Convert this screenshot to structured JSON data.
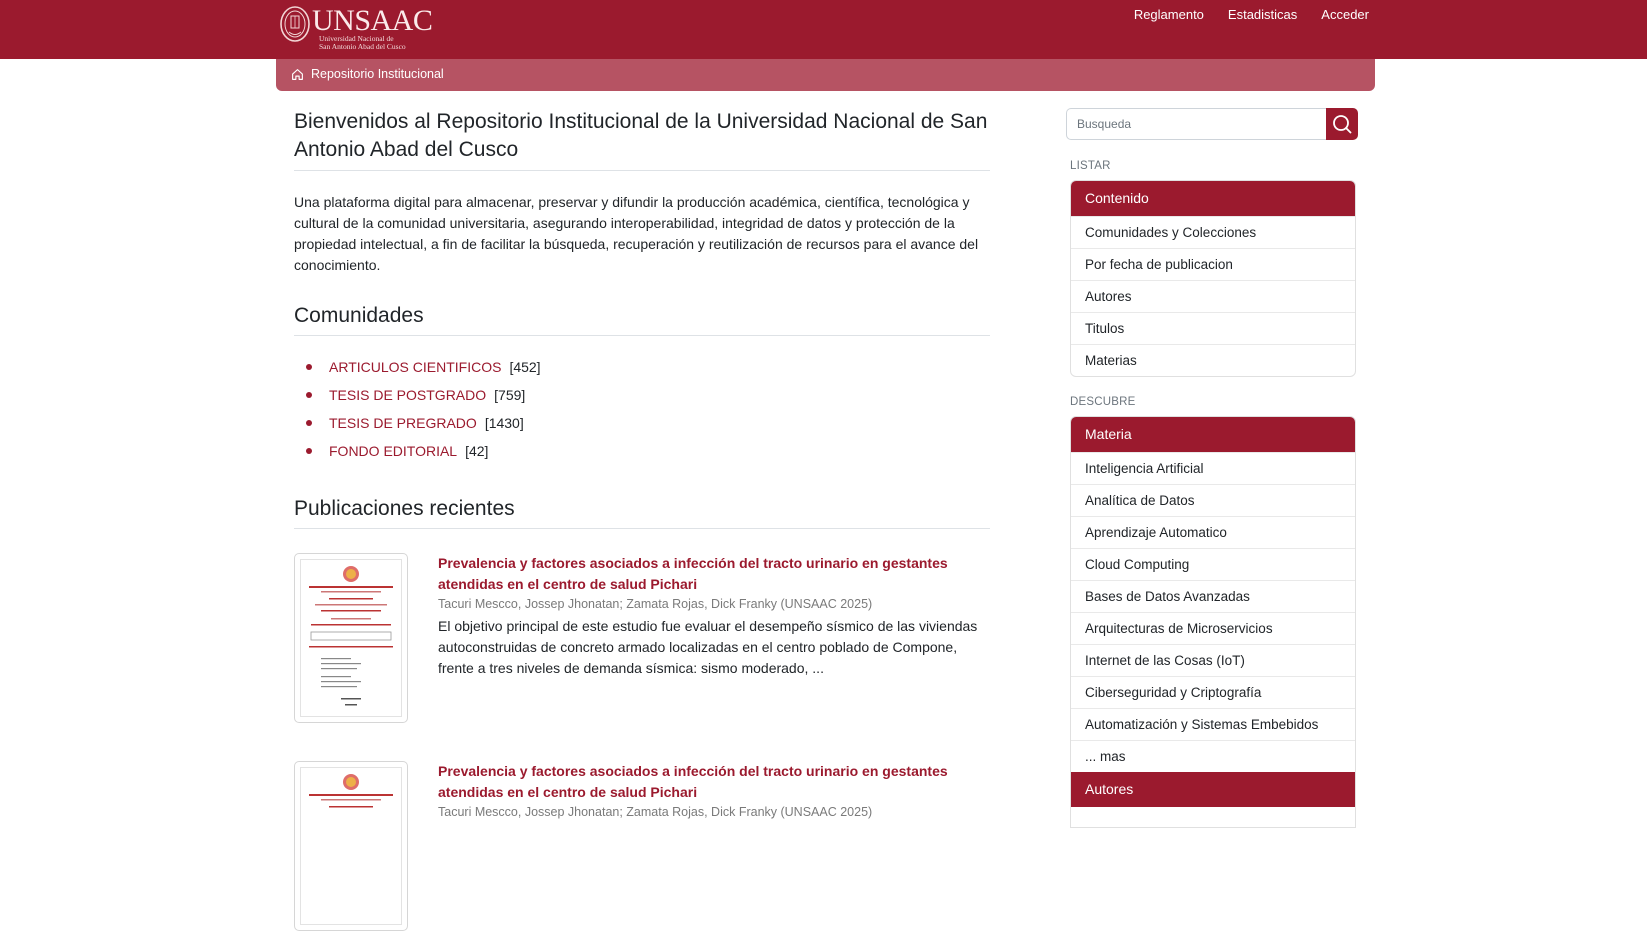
{
  "header": {
    "logo_text": "UNSAAC",
    "logo_subtitle_line1": "Universidad Nacional de",
    "logo_subtitle_line2": "San Antonio Abad del Cusco",
    "nav": [
      {
        "label": "Reglamento"
      },
      {
        "label": "Estadisticas"
      },
      {
        "label": "Acceder"
      }
    ]
  },
  "breadcrumb": {
    "label": "Repositorio Institucional"
  },
  "main": {
    "title": "Bienvenidos al Repositorio Institucional de la Universidad Nacional de San Antonio Abad del Cusco",
    "intro": "Una plataforma digital para almacenar, preservar y difundir la producción académica, científica, tecnológica y cultural de la comunidad universitaria, asegurando interoperabilidad, integridad de datos y protección de la propiedad intelectual, a fin de facilitar la búsqueda, recuperación y reutilización de recursos para el avance del conocimiento.",
    "communities_heading": "Comunidades",
    "communities": [
      {
        "name": "ARTICULOS CIENTIFICOS",
        "count": "[452]"
      },
      {
        "name": "TESIS DE POSTGRADO",
        "count": "[759]"
      },
      {
        "name": "TESIS DE PREGRADO",
        "count": "[1430]"
      },
      {
        "name": "FONDO EDITORIAL",
        "count": "[42]"
      }
    ],
    "recent_heading": "Publicaciones recientes",
    "publications": [
      {
        "title": "Prevalencia y factores asociados a infección del tracto urinario en gestantes atendidas en el centro de salud Pichari",
        "authors": "Tacuri Mescco, Jossep Jhonatan; Zamata Rojas, Dick Franky (UNSAAC 2025)",
        "abstract": "El objetivo principal de este estudio fue evaluar el desempeño sísmico de las viviendas autoconstruidas de concreto armado localizadas en el centro poblado de Compone, frente a tres niveles de demanda sísmica: sismo moderado, ..."
      },
      {
        "title": "Prevalencia y factores asociados a infección del tracto urinario en gestantes atendidas en el centro de salud Pichari",
        "authors": "Tacuri Mescco, Jossep Jhonatan; Zamata Rojas, Dick Franky (UNSAAC 2025)",
        "abstract": ""
      }
    ]
  },
  "sidebar": {
    "search_placeholder": "Busqueda",
    "listar_label": "LISTAR",
    "listar_group": {
      "heading": "Contenido",
      "items": [
        "Comunidades y Colecciones",
        "Por fecha de publicacion",
        "Autores",
        "Titulos",
        "Materias"
      ]
    },
    "descubre_label": "DESCUBRE",
    "descubre_group": {
      "heading": "Materia",
      "items": [
        "Inteligencia Artificial",
        "Analítica de Datos",
        "Aprendizaje Automatico",
        "Cloud Computing",
        "Bases de Datos Avanzadas",
        "Arquitecturas de Microservicios",
        "Internet de las Cosas (IoT)",
        "Ciberseguridad y Criptografía",
        "Automatización y Sistemas Embebidos",
        "... mas"
      ],
      "next_heading": "Autores"
    }
  },
  "colors": {
    "brand": "#9b1a2e",
    "breadcrumb": "#b65363"
  }
}
